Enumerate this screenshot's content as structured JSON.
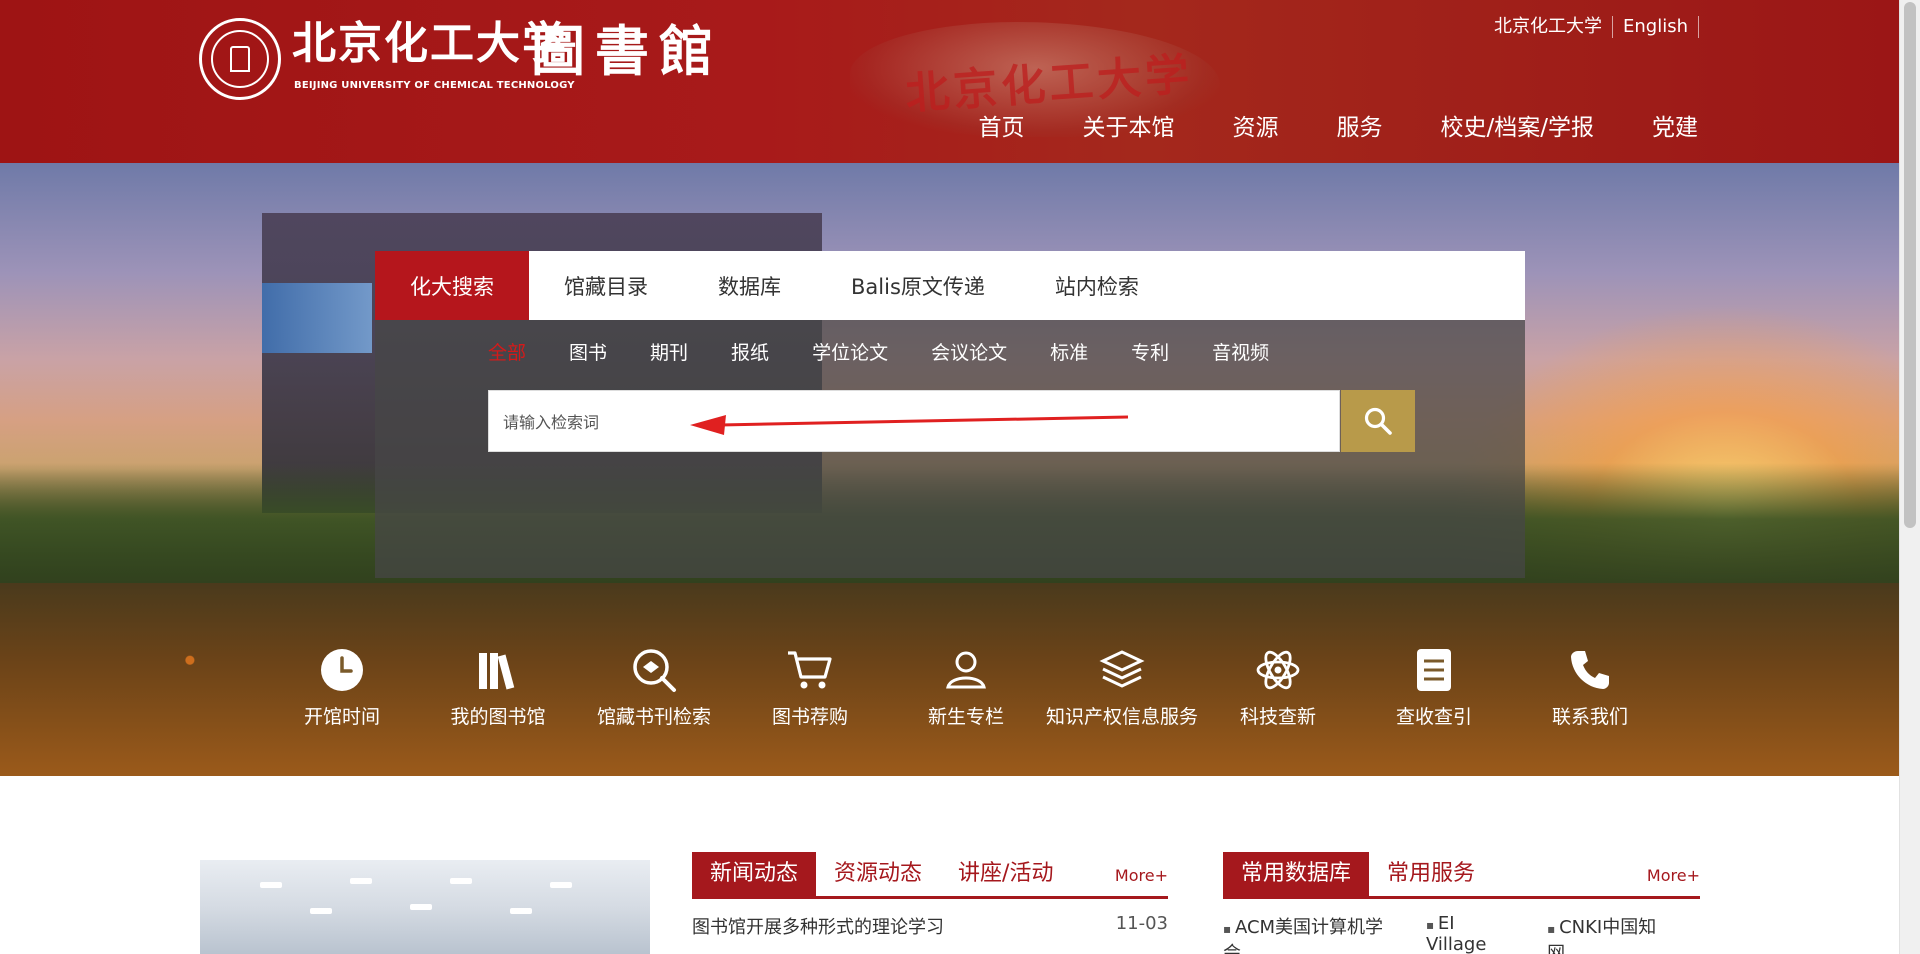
{
  "header": {
    "logo_cn": "北京化工大学",
    "logo_en": "BEIJING UNIVERSITY OF CHEMICAL TECHNOLOGY",
    "logo_library": "圖書館",
    "rock_text": "北京化工大学",
    "top_links": [
      "北京化工大学",
      "English"
    ],
    "nav": [
      "首页",
      "关于本馆",
      "资源",
      "服务",
      "校史/档案/学报",
      "党建"
    ]
  },
  "search": {
    "tabs": [
      "化大搜索",
      "馆藏目录",
      "数据库",
      "Balis原文传递",
      "站内检索"
    ],
    "active_tab": 0,
    "filters": [
      "全部",
      "图书",
      "期刊",
      "报纸",
      "学位论文",
      "会议论文",
      "标准",
      "专利",
      "音视频"
    ],
    "active_filter": 0,
    "placeholder": "请输入检索词",
    "button_icon": "search-icon"
  },
  "quick_links": [
    {
      "label": "开馆时间",
      "icon": "clock-icon"
    },
    {
      "label": "我的图书馆",
      "icon": "books-icon"
    },
    {
      "label": "馆藏书刊检索",
      "icon": "catalog-search-icon"
    },
    {
      "label": "图书荐购",
      "icon": "cart-icon"
    },
    {
      "label": "新生专栏",
      "icon": "user-icon"
    },
    {
      "label": "知识产权信息服务",
      "icon": "layers-icon"
    },
    {
      "label": "科技查新",
      "icon": "atom-icon"
    },
    {
      "label": "查收查引",
      "icon": "document-icon"
    },
    {
      "label": "联系我们",
      "icon": "phone-icon"
    }
  ],
  "news": {
    "tabs": [
      "新闻动态",
      "资源动态",
      "讲座/活动"
    ],
    "more": "More+",
    "items": [
      {
        "title": "图书馆开展多种形式的理论学习",
        "date": "11-03"
      }
    ]
  },
  "databases": {
    "tabs": [
      "常用数据库",
      "常用服务"
    ],
    "more": "More+",
    "items": [
      "ACM美国计算机学会",
      "EI Village",
      "CNKI中国知网"
    ]
  },
  "colors": {
    "brand_red": "#a5181d",
    "search_gold": "#b89a4a",
    "active_filter": "#d41a1a"
  }
}
